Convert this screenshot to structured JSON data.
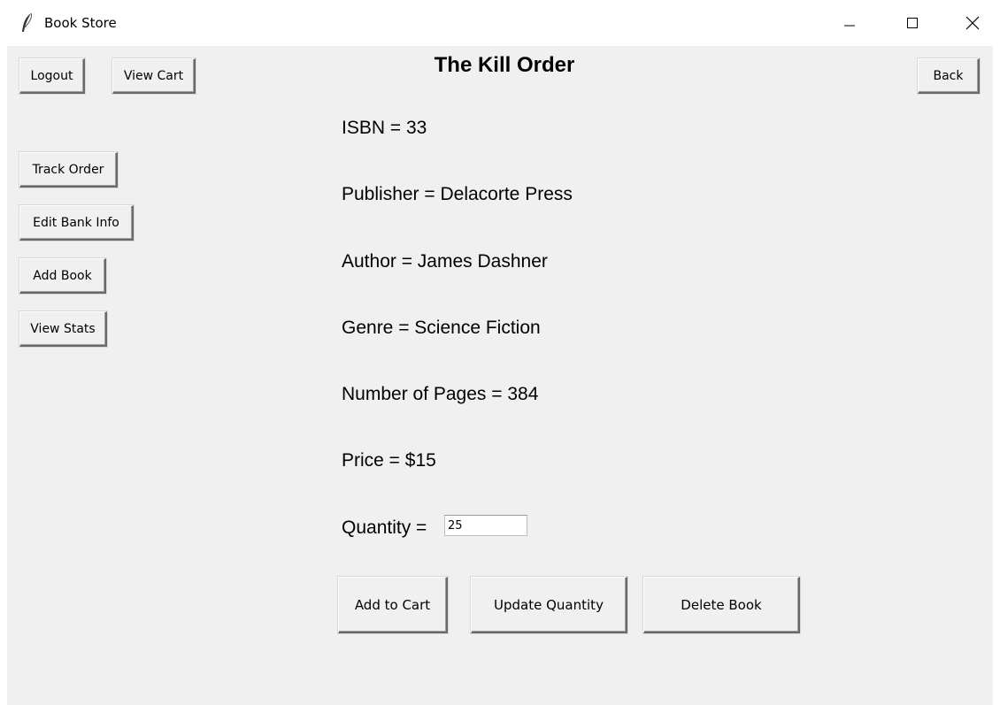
{
  "window": {
    "title": "Book Store",
    "icons": {
      "app": "feather-icon",
      "minimize": "minimize-icon",
      "maximize": "maximize-icon",
      "close": "close-icon"
    }
  },
  "nav": {
    "logout_label": "Logout",
    "view_cart_label": "View Cart",
    "back_label": "Back",
    "track_order_label": "Track Order",
    "edit_bank_info_label": "Edit Bank Info",
    "add_book_label": "Add Book",
    "view_stats_label": "View Stats"
  },
  "book": {
    "title": "The Kill Order",
    "isbn": "ISBN = 33",
    "publisher": "Publisher = Delacorte Press",
    "author": "Author = James Dashner",
    "genre": "Genre = Science Fiction",
    "pages": "Number of Pages = 384",
    "price": "Price = $15",
    "quantity_label": "Quantity =",
    "quantity_value": "25"
  },
  "actions": {
    "add_to_cart_label": "Add to Cart",
    "update_quantity_label": "Update Quantity",
    "delete_book_label": "Delete Book"
  },
  "colors": {
    "background": "#f0f0f0",
    "titlebar": "#ffffff",
    "text": "#000000"
  }
}
